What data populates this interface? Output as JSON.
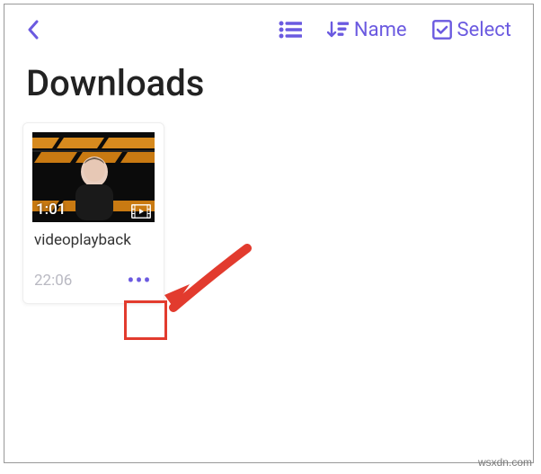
{
  "header": {
    "sort_label": "Name",
    "select_label": "Select"
  },
  "page": {
    "title": "Downloads"
  },
  "files": [
    {
      "name": "videoplayback",
      "duration": "1:01",
      "timestamp": "22:06"
    }
  ],
  "watermark": "wsxdn.com",
  "accent_color": "#6b5ae0",
  "highlight_color": "#e23b2e"
}
